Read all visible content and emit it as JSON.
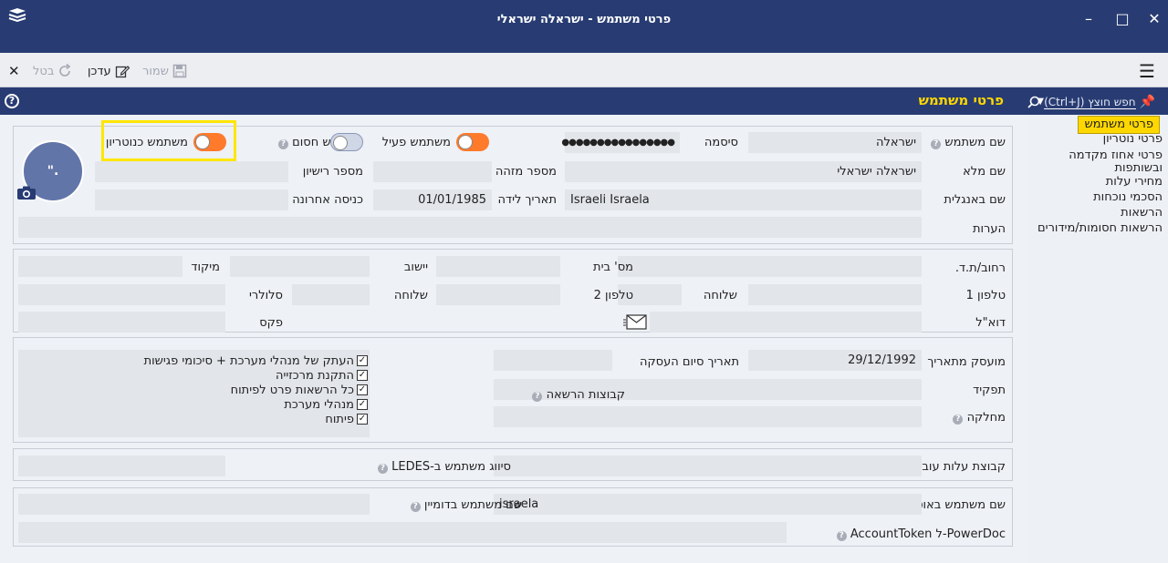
{
  "window": {
    "title": "פרטי משתמש - ישראלה ישראלי"
  },
  "toolbar": {
    "save_label": "שמור",
    "edit_label": "עדכן",
    "cancel_label": "בטל"
  },
  "header": {
    "page_title": "פרטי משתמש",
    "search_placeholder": "חפש חוצץ (Ctrl+J)"
  },
  "sidebar": {
    "items": [
      {
        "label": "פרטי משתמש",
        "active": true
      },
      {
        "label": "פרטי נוטריון"
      },
      {
        "label": "פרטי אחוז מקדמה ובשותפות"
      },
      {
        "label": "מחירי עלות"
      },
      {
        "label": "הסכמי נוכחות"
      },
      {
        "label": "הרשאות"
      },
      {
        "label": "הרשאות חסומות/מידורים"
      }
    ]
  },
  "user": {
    "username_label": "שם משתמש",
    "username_value": "ישראלה",
    "password_label": "סיסמה",
    "password_value": "●●●●●●●●●●●●●●●●",
    "active_label": "משתמש פעיל",
    "blocked_label": "משתמש חסום",
    "notary_label": "משתמש כנוטריון",
    "fullname_label": "שם מלא",
    "fullname_value": "ישראלה ישראלי",
    "id_label": "מספר מזהה",
    "license_label": "מספר רישיון",
    "english_name_label": "שם באנגלית",
    "english_name_value": "Israeli Israela",
    "birthdate_label": "תאריך לידה",
    "birthdate_value": "01/01/1985",
    "last_login_label": "כניסה אחרונה",
    "notes_label": "הערות",
    "avatar_initials": "\"."
  },
  "address": {
    "street_label": "רחוב/ת.ד.",
    "house_label": "מס' בית",
    "city_label": "יישוב",
    "zip_label": "מיקוד",
    "phone1_label": "טלפון 1",
    "ext1_label": "שלוחה",
    "phone2_label": "טלפון 2",
    "ext2_label": "שלוחה",
    "mobile_label": "סלולרי",
    "email_label": "דוא\"ל",
    "fax_label": "פקס"
  },
  "employment": {
    "employed_from_label": "מועסק מתאריך",
    "employed_from_value": "29/12/1992",
    "end_date_label": "תאריך סיום העסקה",
    "role_label": "תפקיד",
    "department_label": "מחלקה",
    "permission_groups_label": "קבוצות הרשאה",
    "groups": [
      "העתק של מנהלי מערכת + סיכומי פגישות",
      "התקנת מרכזייה",
      "כל הרשאות פרט לפיתוח",
      "מנהלי מערכת",
      "פיתוח"
    ]
  },
  "misc": {
    "cost_group_label": "קבוצת עלות עובדים",
    "ledes_label": "סיווג משתמש ב-LEDES",
    "outlook_label": "שם משתמש באוטלוק",
    "outlook_value": "israela",
    "domain_label": "שם משתמש בדומיין",
    "powerdoc_label": "PowerDoc-ל AccountToken"
  },
  "colors": {
    "navy": "#283c73",
    "accent_yellow": "#ffd700",
    "toggle_on": "#ff7a2a"
  }
}
